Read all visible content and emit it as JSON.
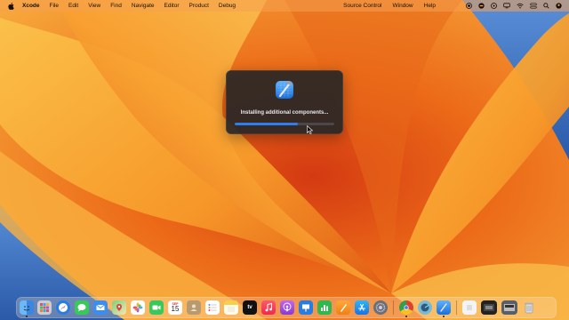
{
  "menubar": {
    "app_name": "Xcode",
    "items": [
      "File",
      "Edit",
      "View",
      "Find",
      "Navigate",
      "Editor",
      "Product",
      "Debug",
      "Source Control",
      "Window",
      "Help"
    ]
  },
  "dialog": {
    "message": "Installing additional components...",
    "progress": 0.63
  },
  "dock": {
    "apps": [
      "Finder",
      "Launchpad",
      "Safari",
      "Messages",
      "Mail",
      "Maps",
      "Photos",
      "FaceTime",
      "Calendar",
      "Contacts",
      "Reminders",
      "Notes",
      "TV",
      "Music",
      "Podcasts",
      "Keynote",
      "Numbers",
      "Pages",
      "App Store",
      "System Settings",
      "Chrome",
      "Network Radar",
      "Xcode",
      "Document",
      "Screenshot",
      "Downloads",
      "Trash"
    ],
    "calendar_month": "SEP",
    "calendar_day": "15",
    "tv_label": "tv"
  },
  "colors": {
    "accent": "#2c7ff0",
    "dialog_bg": "#282626"
  }
}
